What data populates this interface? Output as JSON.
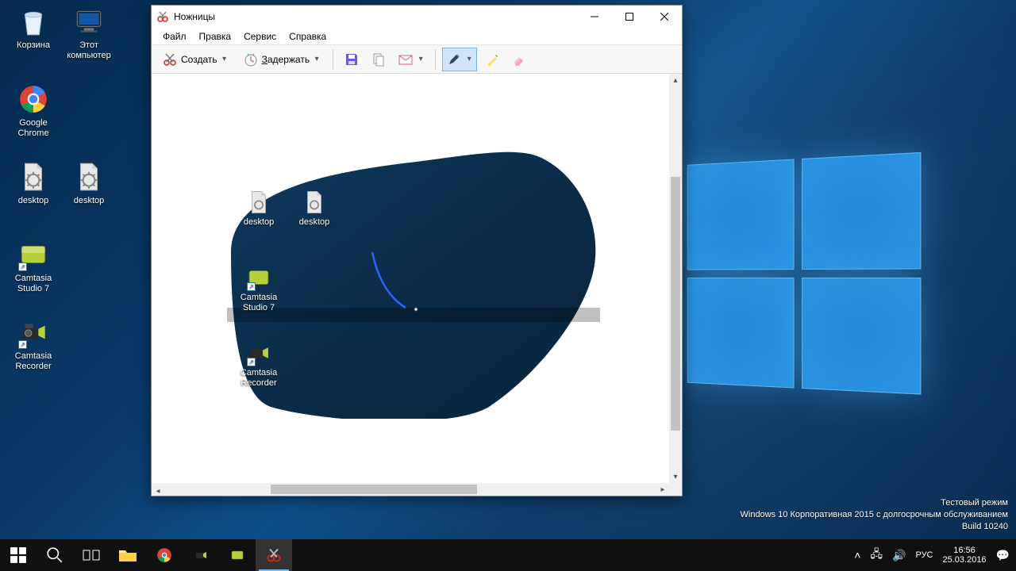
{
  "desktop": {
    "icons": {
      "recycle": "Корзина",
      "thispc": "Этот компьютер",
      "chrome": "Google Chrome",
      "desktop1": "desktop",
      "desktop2": "desktop",
      "camtasia_studio": "Camtasia Studio 7",
      "camtasia_recorder": "Camtasia Recorder"
    },
    "watermark": {
      "line1": "Тестовый режим",
      "line2": "Windows 10 Корпоративная 2015 с долгосрочным обслуживанием",
      "line3": "Build 10240"
    }
  },
  "taskbar": {
    "lang": "РУС",
    "time": "16:56",
    "date": "25.03.2016"
  },
  "window": {
    "title": "Ножницы",
    "menu": {
      "file": "Файл",
      "edit": "Правка",
      "tools": "Сервис",
      "help": "Справка"
    },
    "toolbar": {
      "new": "Создать",
      "delay": "Задержать"
    },
    "snip_icons": {
      "desktop1": "desktop",
      "desktop2": "desktop",
      "camtasia_studio": "Camtasia Studio 7",
      "camtasia_recorder": "Camtasia Recorder"
    }
  }
}
